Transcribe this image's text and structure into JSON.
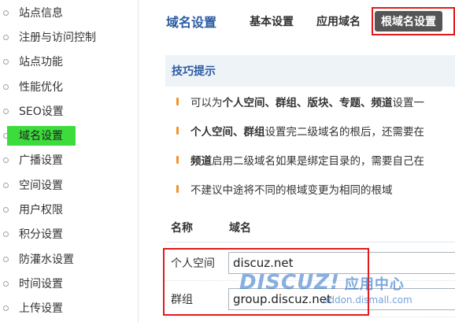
{
  "sidebar": {
    "items": [
      {
        "label": "站点信息",
        "active": false
      },
      {
        "label": "注册与访问控制",
        "active": false
      },
      {
        "label": "站点功能",
        "active": false
      },
      {
        "label": "性能优化",
        "active": false
      },
      {
        "label": "SEO设置",
        "active": false
      },
      {
        "label": "域名设置",
        "active": true
      },
      {
        "label": "广播设置",
        "active": false
      },
      {
        "label": "空间设置",
        "active": false
      },
      {
        "label": "用户权限",
        "active": false
      },
      {
        "label": "积分设置",
        "active": false
      },
      {
        "label": "防灌水设置",
        "active": false
      },
      {
        "label": "时间设置",
        "active": false
      },
      {
        "label": "上传设置",
        "active": false
      }
    ],
    "active_color": "#3cdc3c"
  },
  "header": {
    "title": "域名设置",
    "tabs": [
      {
        "label": "基本设置"
      },
      {
        "label": "应用域名"
      },
      {
        "label": "根域名设置",
        "active": true
      }
    ]
  },
  "tips": {
    "title": "技巧提示",
    "lines": [
      {
        "parts": [
          {
            "text": "可以为",
            "bold": false
          },
          {
            "text": "个人空间、群组、版块、专题、频道",
            "bold": true
          },
          {
            "text": "设置一",
            "bold": false
          }
        ]
      },
      {
        "parts": [
          {
            "text": "个人空间、群组",
            "bold": true
          },
          {
            "text": "设置完二级域名的根后，还需要在",
            "bold": false
          }
        ]
      },
      {
        "parts": [
          {
            "text": "频道",
            "bold": true
          },
          {
            "text": "启用二级域名如果是绑定目录的，需要自己在",
            "bold": false
          }
        ]
      },
      {
        "parts": [
          {
            "text": "不建议中途将不同的根域变更为相同的根域",
            "bold": false
          }
        ]
      }
    ]
  },
  "table": {
    "col_name": "名称",
    "col_domain": "域名",
    "rows": [
      {
        "label": "个人空间",
        "value": "discuz.net"
      },
      {
        "label": "群组",
        "value": "group.discuz.net"
      }
    ]
  },
  "watermark": {
    "logo": "DISCUZ!",
    "logo_cn": "应用中心",
    "url": "addon.dismall.com"
  },
  "colors": {
    "accent": "#2b5ba3",
    "highlight_box": "#e21a1a",
    "tip_bullet": "#f0932c"
  }
}
